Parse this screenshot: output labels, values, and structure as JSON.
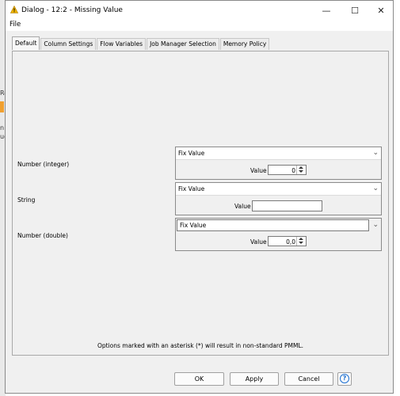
{
  "background": {
    "fragments": [
      "Re",
      "n",
      "ud"
    ]
  },
  "window": {
    "title": "Dialog - 12:2 - Missing Value",
    "controls": {
      "minimize": "—",
      "maximize": "☐",
      "close": "✕"
    }
  },
  "menu": {
    "file": "File"
  },
  "tabs": [
    {
      "label": "Default",
      "active": true
    },
    {
      "label": "Column Settings",
      "active": false
    },
    {
      "label": "Flow Variables",
      "active": false
    },
    {
      "label": "Job Manager Selection",
      "active": false
    },
    {
      "label": "Memory Policy",
      "active": false
    }
  ],
  "rows": [
    {
      "label": "Number (integer)",
      "selected": "Fix Value",
      "field_label": "Value",
      "value": "0"
    },
    {
      "label": "String",
      "selected": "Fix Value",
      "field_label": "Value",
      "value": ""
    },
    {
      "label": "Number (double)",
      "selected": "Fix Value",
      "field_label": "Value",
      "value": "0,0"
    }
  ],
  "note": "Options marked with an asterisk (*) will result in non-standard PMML.",
  "buttons": {
    "ok": "OK",
    "apply": "Apply",
    "cancel": "Cancel",
    "help": "?"
  },
  "colors": {
    "accent": "#1c6fd1",
    "warning": "#f0b400"
  }
}
